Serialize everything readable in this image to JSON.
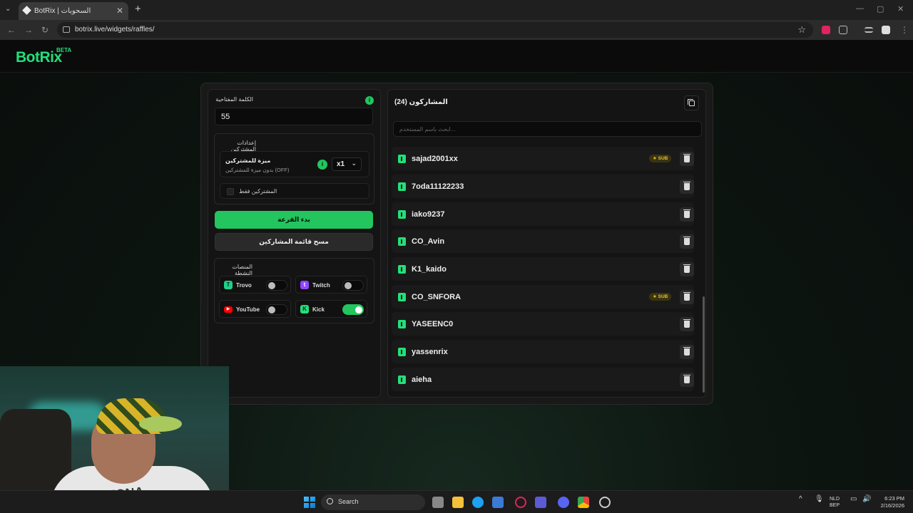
{
  "browser": {
    "tab_title": "BotRix | السحوبات",
    "tab_close": "✕",
    "tab_list": "⌄",
    "new_tab": "+",
    "url": "botrix.live/widgets/raffles/",
    "win_min": "—",
    "win_max": "▢",
    "win_close": "✕"
  },
  "app": {
    "logo": "BotRix",
    "beta": "BETA"
  },
  "settings": {
    "keyword_label": "الكلمة المفتاحية",
    "keyword_value": "55",
    "participants_settings_label": "إعدادات المشتركين",
    "sub_advantage_title": "ميزة للمشتركين",
    "sub_advantage_desc": "بدون ميزة للمشتركين (OFF)",
    "multiplier": "x1",
    "subs_only_label": "المشتركين فقط",
    "start_button": "بدء القرعة",
    "clear_button": "مسح قائمة المشاركين",
    "active_platforms_label": "المنصات النشطة"
  },
  "platforms": [
    {
      "name": "Trovo",
      "enabled": false,
      "color": "#1fd18a"
    },
    {
      "name": "Twitch",
      "enabled": false,
      "color": "#9146ff"
    },
    {
      "name": "YouTube",
      "enabled": false,
      "color": "#ff0000"
    },
    {
      "name": "Kick",
      "enabled": true,
      "color": "#22e07a"
    }
  ],
  "participants": {
    "title": "المشاركون (24)",
    "search_placeholder": "ابحث باسم المستخدم...",
    "list": [
      {
        "name": "sajad2001xx",
        "sub": true
      },
      {
        "name": "7oda11122233",
        "sub": false
      },
      {
        "name": "iako9237",
        "sub": false
      },
      {
        "name": "CO_Avin",
        "sub": false
      },
      {
        "name": "K1_kaido",
        "sub": false
      },
      {
        "name": "CO_SNFORA",
        "sub": true
      },
      {
        "name": "YASEENC0",
        "sub": false
      },
      {
        "name": "yassenrix",
        "sub": false
      },
      {
        "name": "aieha",
        "sub": false
      }
    ],
    "sub_badge": "SUB"
  },
  "webcam": {
    "shirt_text": "ARIZONA"
  },
  "taskbar": {
    "search_label": "Search",
    "lang_top": "NLD",
    "lang_bottom": "BEP",
    "time": "6:23 PM",
    "date": "2/16/2026"
  },
  "colors": {
    "accent": "#22c55e",
    "sub_badge": "#e6c02b"
  }
}
